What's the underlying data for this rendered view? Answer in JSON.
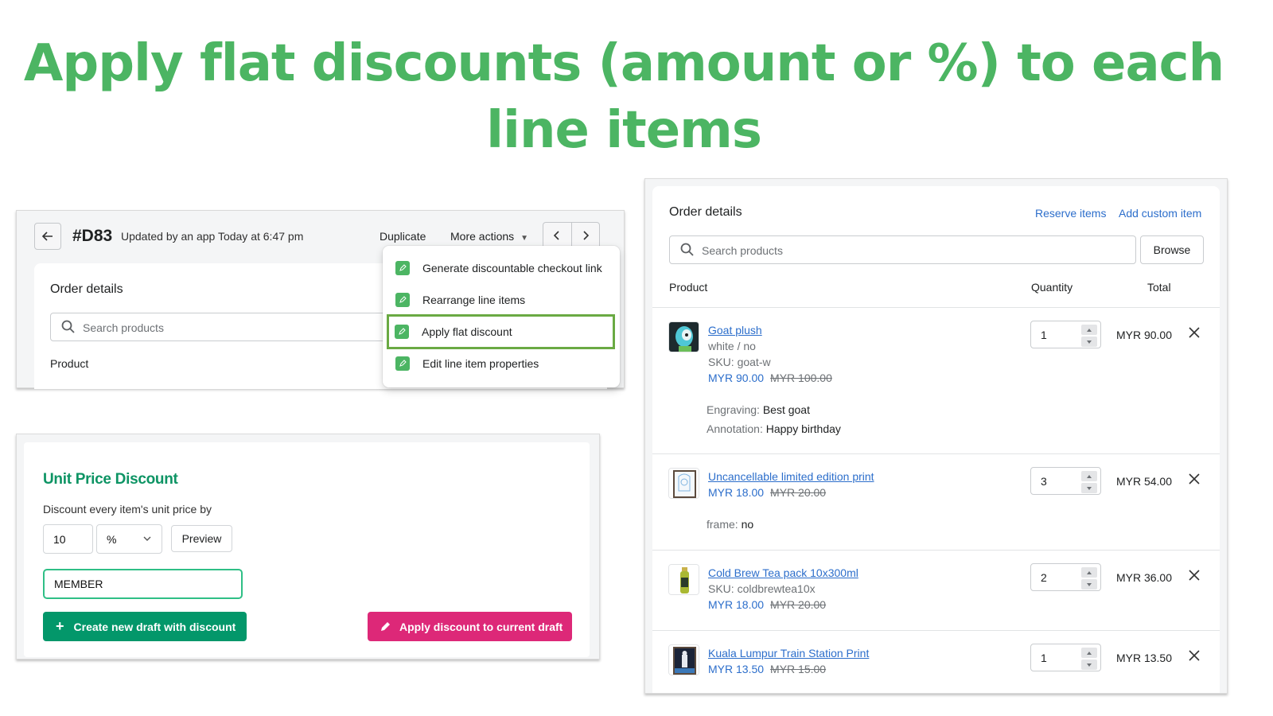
{
  "headline": {
    "line1": "Apply flat discounts (amount or %) to each",
    "line2": "line items",
    "color": "#4cb563"
  },
  "order_header": {
    "back_icon": "arrow-left-icon",
    "order_id": "#D83",
    "meta": "Updated by an app Today at 6:47 pm",
    "duplicate_label": "Duplicate",
    "more_actions_label": "More actions",
    "prev_icon": "chevron-left-icon",
    "next_icon": "chevron-right-icon",
    "card_title": "Order details",
    "search_placeholder": "Search products",
    "product_column": "Product",
    "more_actions_menu": [
      {
        "label": "Generate discountable checkout link",
        "icon": "app-pencil-icon",
        "highlighted": false
      },
      {
        "label": "Rearrange line items",
        "icon": "app-pencil-icon",
        "highlighted": false
      },
      {
        "label": "Apply flat discount",
        "icon": "app-pencil-icon",
        "highlighted": true
      },
      {
        "label": "Edit line item properties",
        "icon": "app-pencil-icon",
        "highlighted": false
      }
    ]
  },
  "discount_form": {
    "title": "Unit Price Discount",
    "description": "Discount every item's unit price by",
    "amount_value": "10",
    "unit_selected": "%",
    "preview_label": "Preview",
    "code_value": "MEMBER",
    "create_button_label": "Create new draft with discount",
    "apply_button_label": "Apply discount to current draft",
    "colors": {
      "title": "#0d9464",
      "create_button": "#03976a",
      "apply_button": "#dd2878",
      "focus_border": "#2fbf86"
    }
  },
  "order_details": {
    "title": "Order details",
    "reserve_items_label": "Reserve items",
    "add_custom_item_label": "Add custom item",
    "search_placeholder": "Search products",
    "browse_label": "Browse",
    "columns": {
      "product": "Product",
      "quantity": "Quantity",
      "total": "Total"
    },
    "line_items": [
      {
        "name": "Goat plush",
        "variant": "white / no",
        "sku": "SKU: goat-w",
        "price": "MYR 90.00",
        "original_price": "MYR 100.00",
        "properties": [
          {
            "key": "Engraving:",
            "value": "Best goat"
          },
          {
            "key": "Annotation:",
            "value": "Happy birthday"
          }
        ],
        "quantity": "1",
        "total": "MYR 90.00"
      },
      {
        "name": "Uncancellable limited edition print",
        "price": "MYR 18.00",
        "original_price": "MYR 20.00",
        "properties": [
          {
            "key": "frame:",
            "value": "no"
          }
        ],
        "quantity": "3",
        "total": "MYR 54.00"
      },
      {
        "name": "Cold Brew Tea pack 10x300ml",
        "sku": "SKU: coldbrewtea10x",
        "price": "MYR 18.00",
        "original_price": "MYR 20.00",
        "quantity": "2",
        "total": "MYR 36.00"
      },
      {
        "name": "Kuala Lumpur Train Station Print",
        "price": "MYR 13.50",
        "original_price": "MYR 15.00",
        "quantity": "1",
        "total": "MYR 13.50"
      }
    ]
  }
}
